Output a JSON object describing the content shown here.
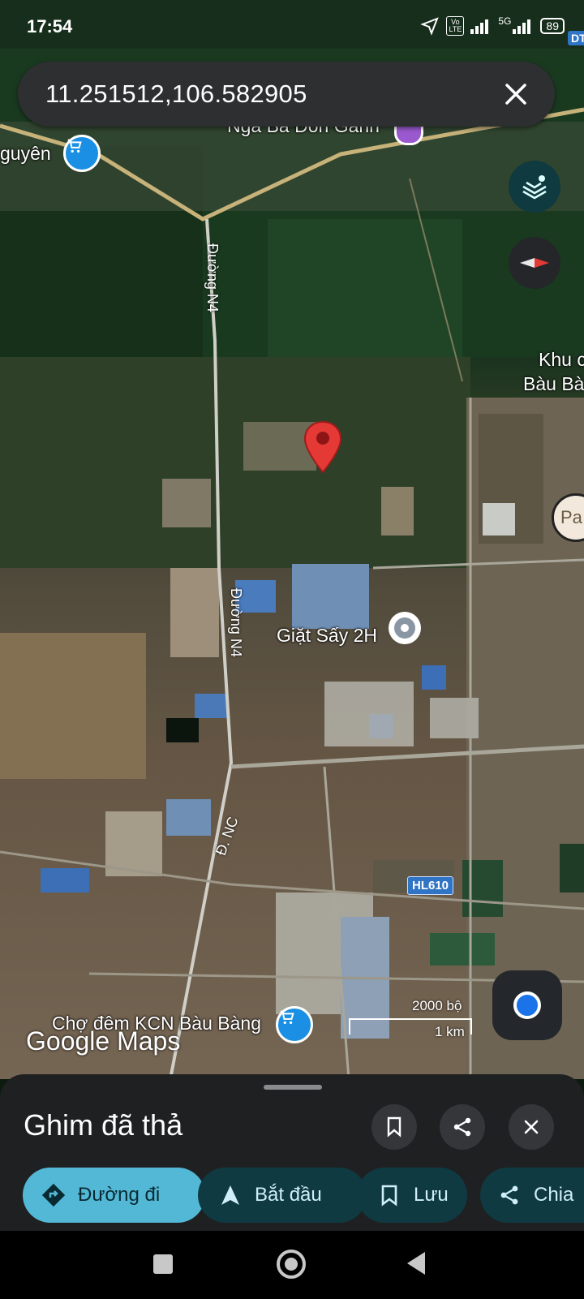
{
  "status_bar": {
    "time": "17:54",
    "network": "5G",
    "volte": "Vo LTE",
    "battery": "89"
  },
  "search": {
    "query": "11.251512,106.582905"
  },
  "map": {
    "corner_badge": "DT",
    "labels": {
      "place_nguyen": "guyên",
      "nga_ba": "Ngã Ba Đồn Gánh",
      "khu": "Khu c",
      "bau_bang": "Bàu Bà",
      "giat_say": "Giặt Sấy 2H",
      "cho_dem": "Chợ đêm KCN Bàu Bàng",
      "pa": "Pa",
      "duong_n4_top": "Đường N4",
      "duong_n4_mid": "Đường N4",
      "duong_nc": "Đ. NC",
      "hl610": "HL610"
    },
    "scale": {
      "imperial": "2000 bộ",
      "metric": "1 km"
    },
    "logo": "Google Maps"
  },
  "sheet": {
    "title": "Ghim đã thả",
    "chips": {
      "directions": "Đường đi",
      "start": "Bắt đầu",
      "save": "Lưu",
      "share": "Chia"
    }
  },
  "colors": {
    "accent": "#52b8d6",
    "chip_dark": "#0f3a42",
    "pin": "#e53935"
  }
}
